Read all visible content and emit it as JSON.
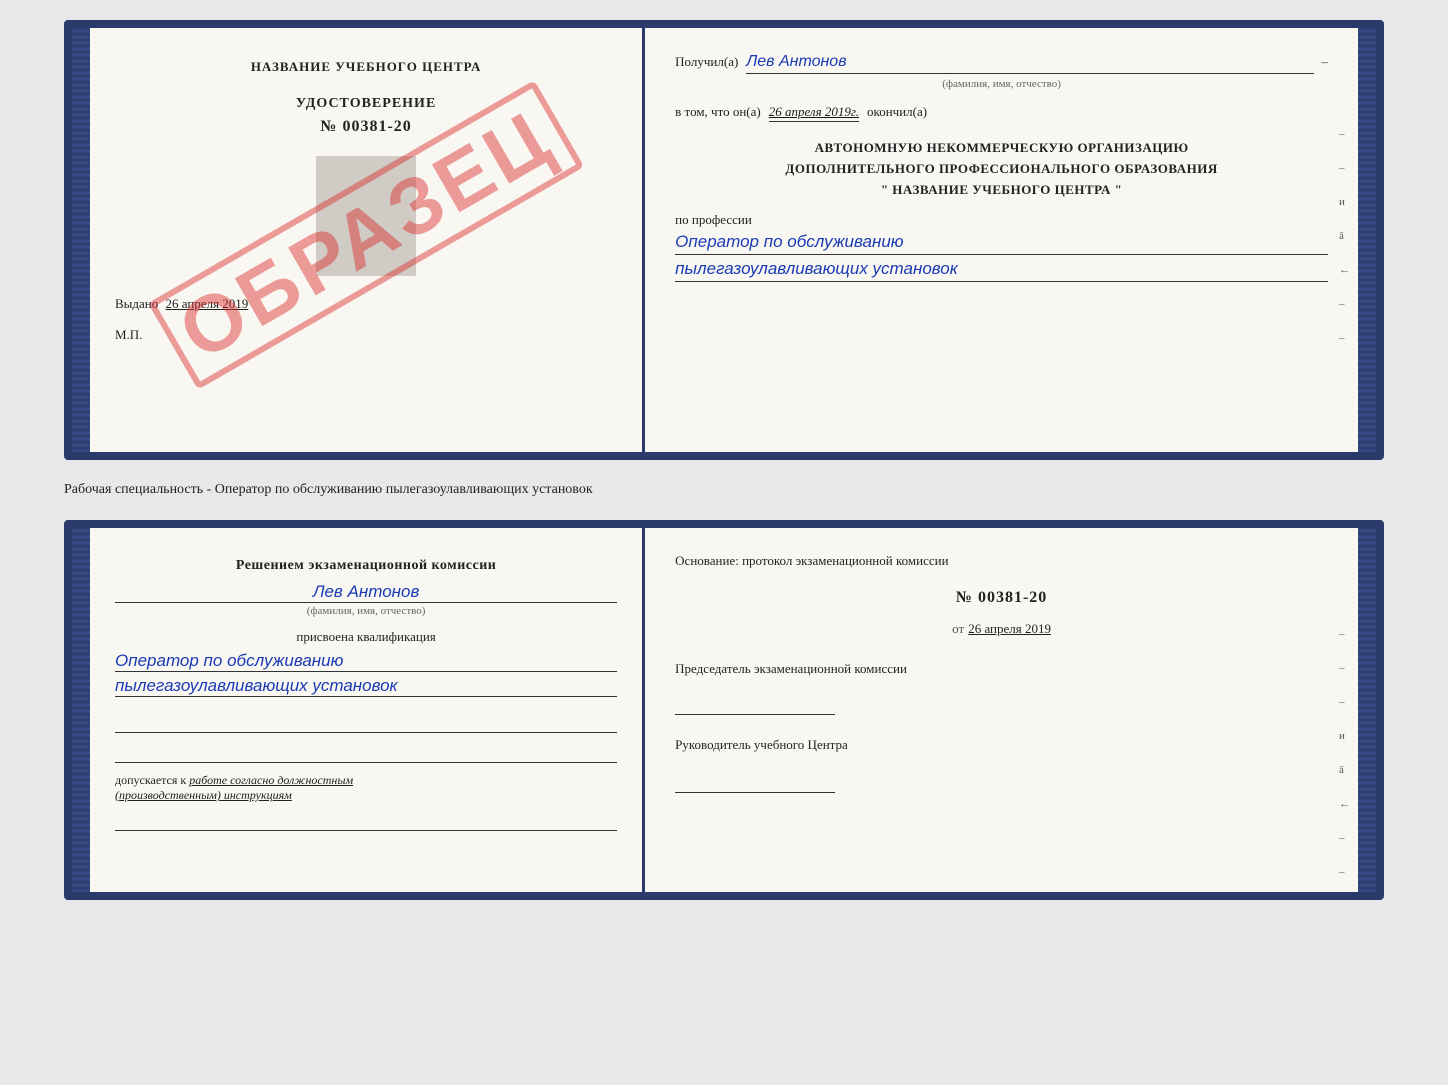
{
  "top_cert": {
    "left": {
      "institution_name": "НАЗВАНИЕ УЧЕБНОГО ЦЕНТРА",
      "cert_type": "УДОСТОВЕРЕНИЕ",
      "cert_number": "№ 00381-20",
      "issue_label": "Выдано",
      "issue_date": "26 апреля 2019",
      "mp_label": "М.П.",
      "stamp_text": "ОБРАЗЕЦ"
    },
    "right": {
      "recipient_label": "Получил(а)",
      "recipient_name": "Лев Антонов",
      "fio_sublabel": "(фамилия, имя, отчество)",
      "date_label": "в том, что он(а)",
      "date_value": "26 апреля 2019г.",
      "finished_label": "окончил(а)",
      "org_line1": "АВТОНОМНУЮ НЕКОММЕРЧЕСКУЮ ОРГАНИЗАЦИЮ",
      "org_line2": "ДОПОЛНИТЕЛЬНОГО ПРОФЕССИОНАЛЬНОГО ОБРАЗОВАНИЯ",
      "org_line3": "\"   НАЗВАНИЕ УЧЕБНОГО ЦЕНТРА   \"",
      "profession_label": "по профессии",
      "profession_line1": "Оператор по обслуживанию",
      "profession_line2": "пылегазоулавливающих установок",
      "side_marks": [
        "–",
        "–",
        "и",
        "ā",
        "←",
        "–",
        "–",
        "–",
        "–"
      ]
    }
  },
  "between": {
    "text": "Рабочая специальность - Оператор по обслуживанию пылегазоулавливающих установок"
  },
  "bottom_cert": {
    "left": {
      "commission_header": "Решением экзаменационной комиссии",
      "person_name": "Лев Антонов",
      "fio_sublabel": "(фамилия, имя, отчество)",
      "assigned_label": "присвоена квалификация",
      "qualification_line1": "Оператор по обслуживанию",
      "qualification_line2": "пылегазоулавливающих установок",
      "admission_label": "допускается к",
      "admission_link": "работе согласно должностным",
      "admission_link2": "(производственным) инструкциям"
    },
    "right": {
      "basis_label": "Основание: протокол экзаменационной комиссии",
      "protocol_number": "№  00381-20",
      "from_label": "от",
      "protocol_date": "26 апреля 2019",
      "chairman_label": "Председатель экзаменационной комиссии",
      "director_label": "Руководитель учебного Центра",
      "side_marks": [
        "–",
        "–",
        "–",
        "и",
        "ā",
        "←",
        "–",
        "–",
        "–",
        "–"
      ]
    }
  }
}
